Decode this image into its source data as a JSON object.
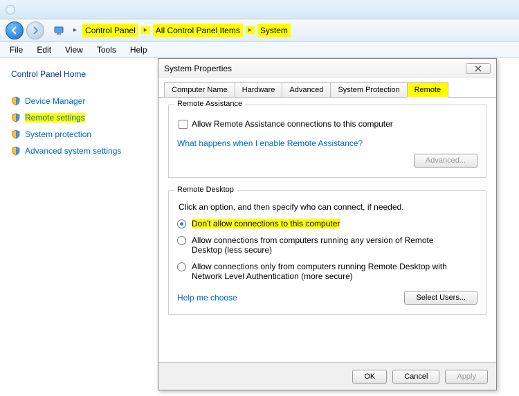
{
  "breadcrumb": {
    "items": [
      "Control Panel",
      "All Control Panel Items",
      "System"
    ]
  },
  "menubar": {
    "items": [
      "File",
      "Edit",
      "View",
      "Tools",
      "Help"
    ]
  },
  "sidebar": {
    "title": "Control Panel Home",
    "items": [
      {
        "label": "Device Manager"
      },
      {
        "label": "Remote settings"
      },
      {
        "label": "System protection"
      },
      {
        "label": "Advanced system settings"
      }
    ]
  },
  "dialog": {
    "title": "System Properties",
    "tabs": [
      "Computer Name",
      "Hardware",
      "Advanced",
      "System Protection",
      "Remote"
    ],
    "active_tab_index": 4,
    "remote_assistance": {
      "group_title": "Remote Assistance",
      "checkbox_label": "Allow Remote Assistance connections to this computer",
      "checked": false,
      "help_link": "What happens when I enable Remote Assistance?",
      "advanced_btn": "Advanced..."
    },
    "remote_desktop": {
      "group_title": "Remote Desktop",
      "instruction": "Click an option, and then specify who can connect, if needed.",
      "options": [
        "Don't allow connections to this computer",
        "Allow connections from computers running any version of Remote Desktop (less secure)",
        "Allow connections only from computers running Remote Desktop with Network Level Authentication (more secure)"
      ],
      "selected_index": 0,
      "help_link": "Help me choose",
      "select_users_btn": "Select Users..."
    },
    "buttons": {
      "ok": "OK",
      "cancel": "Cancel",
      "apply": "Apply"
    }
  }
}
